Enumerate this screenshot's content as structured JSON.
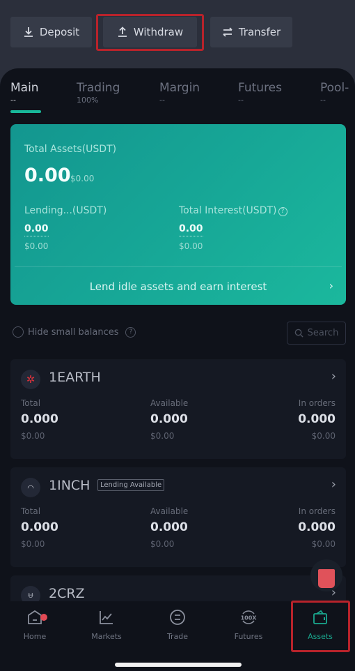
{
  "actions": {
    "deposit": "Deposit",
    "withdraw": "Withdraw",
    "transfer": "Transfer"
  },
  "tabs": [
    {
      "label": "Main",
      "sub": "--",
      "active": true
    },
    {
      "label": "Trading",
      "sub": "100%"
    },
    {
      "label": "Margin",
      "sub": "--"
    },
    {
      "label": "Futures",
      "sub": "--"
    },
    {
      "label": "Pool-",
      "sub": "--"
    }
  ],
  "earn": {
    "total_label": "Total Assets(USDT)",
    "total_value": "0.00",
    "total_usd": "$0.00",
    "lending_label": "Lending...(USDT)",
    "lending_value": "0.00",
    "lending_usd": "$0.00",
    "interest_label": "Total Interest(USDT)",
    "interest_value": "0.00",
    "interest_usd": "$0.00",
    "cta": "Lend idle assets and earn interest"
  },
  "filter": {
    "hide_small": "Hide small balances",
    "search_placeholder": "Search"
  },
  "columns": {
    "total": "Total",
    "available": "Available",
    "in_orders": "In orders"
  },
  "assets": [
    {
      "name": "1EARTH",
      "badge": "",
      "total": "0.000",
      "total_usd": "$0.00",
      "available": "0.000",
      "available_usd": "$0.00",
      "in_orders": "0.000",
      "in_orders_usd": "$0.00"
    },
    {
      "name": "1INCH",
      "badge": "Lending Available",
      "total": "0.000",
      "total_usd": "$0.00",
      "available": "0.000",
      "available_usd": "$0.00",
      "in_orders": "0.000",
      "in_orders_usd": "$0.00"
    },
    {
      "name": "2CRZ",
      "badge": ""
    }
  ],
  "nav": [
    {
      "label": "Home"
    },
    {
      "label": "Markets"
    },
    {
      "label": "Trade"
    },
    {
      "label": "Futures"
    },
    {
      "label": "Assets",
      "active": true
    }
  ],
  "colors": {
    "accent": "#18b89a",
    "highlight": "#b8232b",
    "background": "#0f121a"
  }
}
